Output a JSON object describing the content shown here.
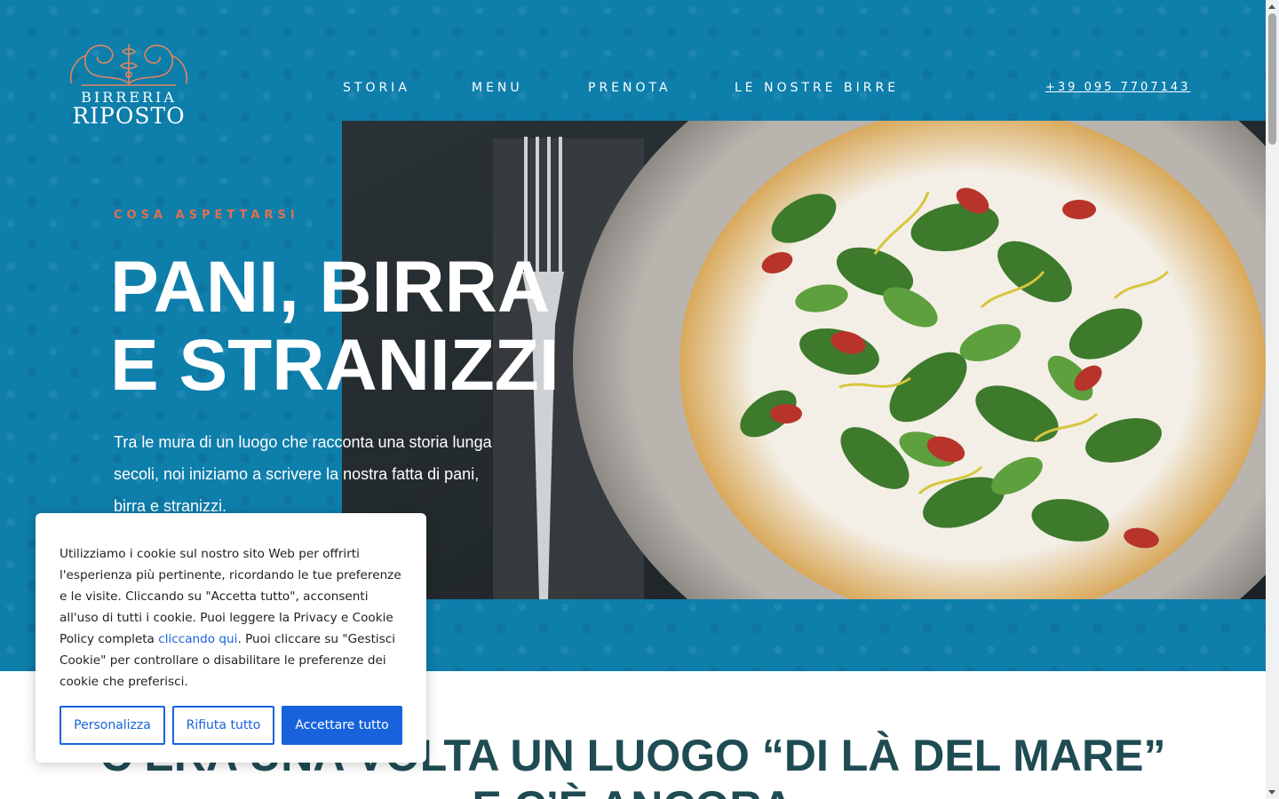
{
  "brand": {
    "line1": "BIRRERIA",
    "line2": "RIPOSTO"
  },
  "nav": {
    "items": [
      {
        "label": "STORIA"
      },
      {
        "label": "MENU"
      },
      {
        "label": "PRENOTA"
      },
      {
        "label": "LE NOSTRE BIRRE"
      }
    ]
  },
  "header": {
    "phone": "+39 095 7707143"
  },
  "hero": {
    "kicker": "COSA ASPETTARSI",
    "headline_line1": "PANI, BIRRA",
    "headline_line2": "E STRANIZZI",
    "intro": "Tra le mura di un luogo che racconta una storia lunga secoli, noi iniziamo a scrivere la nostra fatta di pani, birra e stranizzi."
  },
  "section2": {
    "title_line1": "C’ERA UNA VOLTA UN LUOGO “DI LÀ DEL MARE”",
    "title_line2": "E C’È ANCORA"
  },
  "cookie": {
    "text_before_link": "Utilizziamo i cookie sul nostro sito Web per offrirti l'esperienza più pertinente, ricordando le tue preferenze e le visite. Cliccando su \"Accetta tutto\", acconsenti all'uso di tutti i cookie. Puoi leggere la Privacy e Cookie Policy completa ",
    "link_text": "cliccando qui",
    "text_after_link": ". Puoi cliccare su \"Gestisci Cookie\" per controllare o disabilitare le preferenze dei cookie che preferisci.",
    "btn_customize": "Personalizza",
    "btn_reject": "Rifiuta tutto",
    "btn_accept": "Accettare tutto"
  },
  "colors": {
    "hero_bg": "#0e7eab",
    "kicker": "#e0704a",
    "cookie_accent": "#1863dc",
    "section_title": "#1f4b53"
  },
  "icons": [
    "logo-ornament-icon",
    "scroll-up-icon",
    "scroll-down-icon"
  ]
}
